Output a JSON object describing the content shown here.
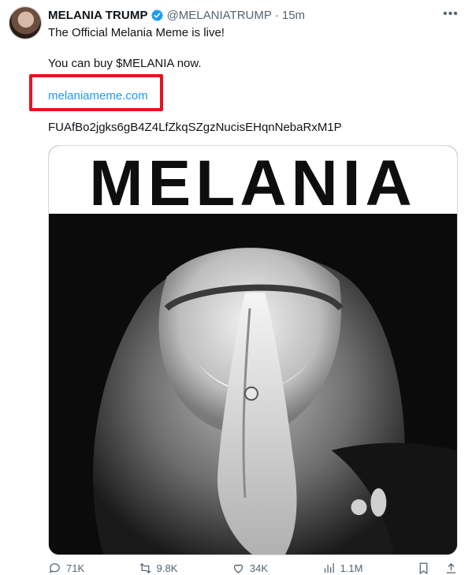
{
  "author": {
    "name": "MELANIA TRUMP",
    "handle": "@MELANIATRUMP",
    "separator": "·",
    "time": "15m",
    "verified_color": "#1d9bf0"
  },
  "tweet": {
    "line1": "The Official Melania Meme is live!",
    "line2": "You can buy $MELANIA now.",
    "link": "melaniameme.com",
    "contract": "FUAfBo2jgks6gB4Z4LfZkqSZgzNucisEHqnNebaRxM1P"
  },
  "media": {
    "headline": "MELANIA"
  },
  "actions": {
    "replies": "71K",
    "reposts": "9.8K",
    "likes": "34K",
    "views": "1.1M"
  },
  "colors": {
    "highlight": "#e8121f",
    "link": "#1d9bf0",
    "muted": "#536471"
  }
}
